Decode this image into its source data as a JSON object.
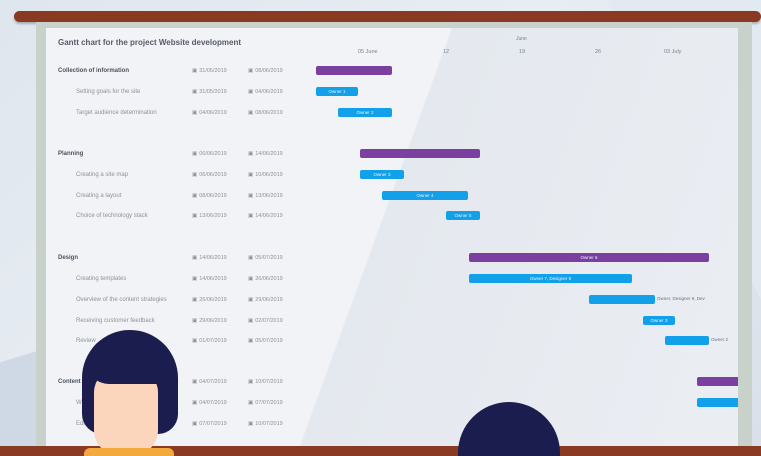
{
  "gantt": {
    "title": "Gantt chart for the project Website development",
    "timeline": {
      "month": "June",
      "days": [
        "05 June",
        "12",
        "19",
        "26",
        "03 July"
      ]
    },
    "rows": [
      {
        "kind": "group",
        "name": "Collection of information",
        "start": "31/05/2019",
        "end": "08/06/2019"
      },
      {
        "kind": "sub",
        "name": "Setting goals for the site",
        "start": "31/05/2019",
        "end": "04/06/2019"
      },
      {
        "kind": "sub",
        "name": "Target audience determination",
        "start": "04/06/2019",
        "end": "08/06/2019"
      },
      {
        "kind": "group",
        "name": "Planning",
        "start": "06/06/2019",
        "end": "14/06/2019"
      },
      {
        "kind": "sub",
        "name": "Creating a site map",
        "start": "06/06/2019",
        "end": "10/06/2019"
      },
      {
        "kind": "sub",
        "name": "Creating a layout",
        "start": "08/06/2019",
        "end": "13/06/2019"
      },
      {
        "kind": "sub",
        "name": "Choice of technology stack",
        "start": "13/06/2019",
        "end": "14/06/2019"
      },
      {
        "kind": "group",
        "name": "Design",
        "start": "14/06/2019",
        "end": "05/07/2019"
      },
      {
        "kind": "sub",
        "name": "Creating templates",
        "start": "14/06/2019",
        "end": "26/06/2019"
      },
      {
        "kind": "sub",
        "name": "Overview of the content strategies",
        "start": "26/06/2019",
        "end": "29/06/2019"
      },
      {
        "kind": "sub",
        "name": "Receiving customer feedback",
        "start": "29/06/2019",
        "end": "02/07/2019"
      },
      {
        "kind": "sub",
        "name": "Review",
        "start": "01/07/2019",
        "end": "05/07/2019"
      },
      {
        "kind": "group",
        "name": "Content",
        "start": "04/07/2019",
        "end": "10/07/2019"
      },
      {
        "kind": "sub",
        "name": "Writing",
        "start": "04/07/2019",
        "end": "07/07/2019"
      },
      {
        "kind": "sub",
        "name": "Editing",
        "start": "07/07/2019",
        "end": "10/07/2019"
      }
    ],
    "bars": [
      {
        "color": "purple",
        "label": ""
      },
      {
        "color": "blue",
        "label": "Owner 1"
      },
      {
        "color": "blue",
        "label": "Owner 2"
      },
      {
        "color": "purple",
        "label": ""
      },
      {
        "color": "blue",
        "label": "Owner 3"
      },
      {
        "color": "blue",
        "label": "Owner 4"
      },
      {
        "color": "blue",
        "label": "Owner 5"
      },
      {
        "color": "purple",
        "label": "Owner 6"
      },
      {
        "color": "blue",
        "label": "Owner 7, Designer 8"
      },
      {
        "color": "blue",
        "label": "",
        "note": "Owner, Designer 9, Dev"
      },
      {
        "color": "blue",
        "label": "Owner 3"
      },
      {
        "color": "blue",
        "label": "",
        "note": "Owner 2"
      },
      {
        "color": "purple",
        "label": ""
      },
      {
        "color": "blue",
        "label": ""
      }
    ],
    "colors": {
      "purple": "#7b3fa0",
      "blue": "#12a0e8",
      "rail": "#8a3a23"
    }
  }
}
